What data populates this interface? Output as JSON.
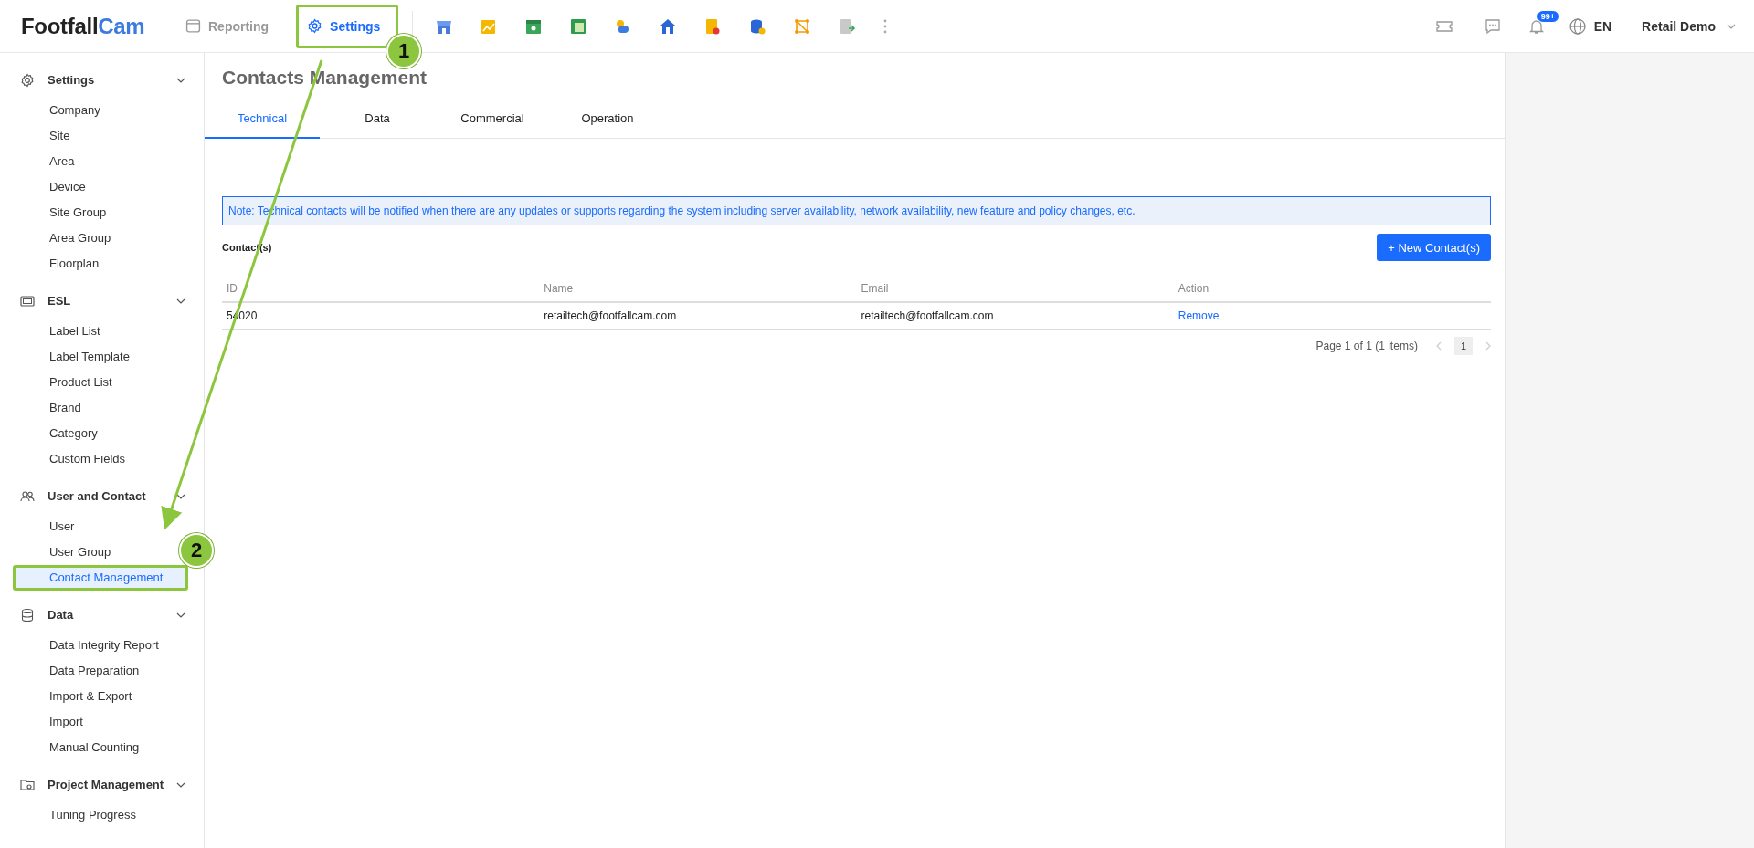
{
  "header": {
    "logo": {
      "main": "Footfall",
      "accent": "Cam"
    },
    "nav": [
      {
        "label": "Reporting",
        "selected": false,
        "highlighted": false
      },
      {
        "label": "Settings",
        "selected": true,
        "highlighted": true
      }
    ],
    "notifications_badge": "99+",
    "language": "EN",
    "user": "Retail Demo"
  },
  "sidebar": {
    "sections": [
      {
        "title": "Settings",
        "expanded": true,
        "items": [
          {
            "label": "Company",
            "selected": false,
            "highlighted": false
          },
          {
            "label": "Site",
            "selected": false,
            "highlighted": false
          },
          {
            "label": "Area",
            "selected": false,
            "highlighted": false
          },
          {
            "label": "Device",
            "selected": false,
            "highlighted": false
          },
          {
            "label": "Site Group",
            "selected": false,
            "highlighted": false
          },
          {
            "label": "Area Group",
            "selected": false,
            "highlighted": false
          },
          {
            "label": "Floorplan",
            "selected": false,
            "highlighted": false
          }
        ]
      },
      {
        "title": "ESL",
        "expanded": true,
        "items": [
          {
            "label": "Label List",
            "selected": false,
            "highlighted": false
          },
          {
            "label": "Label Template",
            "selected": false,
            "highlighted": false
          },
          {
            "label": "Product List",
            "selected": false,
            "highlighted": false
          },
          {
            "label": "Brand",
            "selected": false,
            "highlighted": false
          },
          {
            "label": "Category",
            "selected": false,
            "highlighted": false
          },
          {
            "label": "Custom Fields",
            "selected": false,
            "highlighted": false
          }
        ]
      },
      {
        "title": "User and Contact",
        "expanded": true,
        "items": [
          {
            "label": "User",
            "selected": false,
            "highlighted": false
          },
          {
            "label": "User Group",
            "selected": false,
            "highlighted": false
          },
          {
            "label": "Contact Management",
            "selected": true,
            "highlighted": true
          }
        ]
      },
      {
        "title": "Data",
        "expanded": true,
        "items": [
          {
            "label": "Data Integrity Report",
            "selected": false,
            "highlighted": false
          },
          {
            "label": "Data Preparation",
            "selected": false,
            "highlighted": false
          },
          {
            "label": "Import & Export",
            "selected": false,
            "highlighted": false
          },
          {
            "label": "Import",
            "selected": false,
            "highlighted": false
          },
          {
            "label": "Manual Counting",
            "selected": false,
            "highlighted": false
          }
        ]
      },
      {
        "title": "Project Management",
        "expanded": true,
        "items": [
          {
            "label": "Tuning Progress",
            "selected": false,
            "highlighted": false
          }
        ]
      }
    ]
  },
  "page": {
    "title": "Contacts Management",
    "tabs": [
      {
        "label": "Technical",
        "selected": true
      },
      {
        "label": "Data",
        "selected": false
      },
      {
        "label": "Commercial",
        "selected": false
      },
      {
        "label": "Operation",
        "selected": false
      }
    ],
    "note": "Note: Technical contacts will be notified when there are any updates or supports regarding the system including server availability, network availability, new feature and policy changes, etc.",
    "contacts_label": "Contact(s)",
    "new_button": "+ New Contact(s)",
    "table": {
      "columns": [
        "ID",
        "Name",
        "Email",
        "Action"
      ],
      "rows": [
        {
          "id": "54020",
          "name": "retailtech@footfallcam.com",
          "email": "retailtech@footfallcam.com",
          "action": "Remove"
        }
      ]
    },
    "pagination": {
      "summary": "Page 1 of 1 (1 items)",
      "pages": [
        {
          "label": "1",
          "selected": true
        }
      ]
    }
  },
  "annotations": [
    {
      "number": "1"
    },
    {
      "number": "2"
    }
  ]
}
